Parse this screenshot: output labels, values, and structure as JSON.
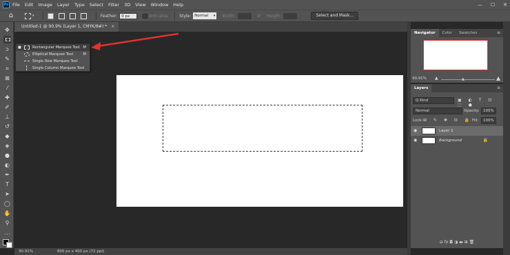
{
  "app": {
    "logo": "Ps"
  },
  "menu": [
    "File",
    "Edit",
    "Image",
    "Layer",
    "Type",
    "Select",
    "Filter",
    "3D",
    "View",
    "Window",
    "Help"
  ],
  "window_controls": {
    "minimize": "—",
    "maximize": "☐",
    "close": "✕"
  },
  "options_bar": {
    "feather_label": "Feather:",
    "feather_value": "0 px",
    "antialias_label": "Anti-alias",
    "style_label": "Style:",
    "style_value": "Normal",
    "width_label": "Width:",
    "height_label": "Height:",
    "swap_glyph": "⇄",
    "select_mask_button": "Select and Mask..."
  },
  "document": {
    "tab_title": "Untitled-1 @ 90.9% (Layer 1, CMYK/8#) *",
    "close_glyph": "×"
  },
  "tool_flyout": {
    "items": [
      {
        "mark": "■",
        "label": "Rectangular Marquee Tool",
        "shortcut": "M",
        "selected": true
      },
      {
        "mark": "",
        "label": "Elliptical Marquee Tool",
        "shortcut": "M",
        "selected": false
      },
      {
        "mark": "",
        "label": "Single Row Marquee Tool",
        "shortcut": "",
        "selected": false
      },
      {
        "mark": "",
        "label": "Single Column Marquee Tool",
        "shortcut": "",
        "selected": false
      }
    ]
  },
  "toolbar": {
    "tools": [
      {
        "name": "move-tool-icon",
        "glyph": "✥"
      },
      {
        "name": "rectangular-marquee-tool-icon",
        "glyph": ""
      },
      {
        "name": "lasso-tool-icon",
        "glyph": "ↄ"
      },
      {
        "name": "quick-selection-tool-icon",
        "glyph": "✎"
      },
      {
        "name": "crop-tool-icon",
        "glyph": "⌗"
      },
      {
        "name": "frame-tool-icon",
        "glyph": "⊠"
      },
      {
        "name": "eyedropper-tool-icon",
        "glyph": "⁄"
      },
      {
        "name": "spot-healing-tool-icon",
        "glyph": "✚"
      },
      {
        "name": "brush-tool-icon",
        "glyph": "✐"
      },
      {
        "name": "clone-stamp-tool-icon",
        "glyph": "⊥"
      },
      {
        "name": "history-brush-tool-icon",
        "glyph": "↺"
      },
      {
        "name": "eraser-tool-icon",
        "glyph": "◆"
      },
      {
        "name": "paint-bucket-tool-icon",
        "glyph": "◈"
      },
      {
        "name": "blur-tool-icon",
        "glyph": "●"
      },
      {
        "name": "dodge-tool-icon",
        "glyph": "◐"
      },
      {
        "name": "pen-tool-icon",
        "glyph": "✒"
      },
      {
        "name": "type-tool-icon",
        "glyph": "T"
      },
      {
        "name": "path-selection-tool-icon",
        "glyph": "➤"
      },
      {
        "name": "ellipse-tool-icon",
        "glyph": "◯"
      },
      {
        "name": "hand-tool-icon",
        "glyph": "✋"
      },
      {
        "name": "zoom-tool-icon",
        "glyph": "⚲"
      },
      {
        "name": "edit-toolbar-icon",
        "glyph": "…"
      }
    ]
  },
  "status_bar": {
    "zoom": "90.91%",
    "doc_size": "800 px x 400 px (72 ppi)",
    "arrow": "›"
  },
  "navigator_panel": {
    "tabs": [
      "Navigator",
      "Color",
      "Swatches"
    ],
    "menu_glyph": "≡",
    "zoom": "90.91%",
    "small_mountain": "▲",
    "large_mountain": "▲",
    "knob": "▲"
  },
  "layers_panel": {
    "tabs": [
      "Layers"
    ],
    "menu_glyph": "≡",
    "filter_kind": "Q Kind",
    "filter_icons": "▣ ◐ T ⊡ ⬚ ●",
    "blend_mode": "Normal",
    "opacity_label": "Opacity:",
    "opacity_value": "100%",
    "lock_label": "Lock:",
    "lock_icons": "⊞ ✎ ✥ ⊡ 🔒",
    "fill_label": "Fill:",
    "fill_value": "100%",
    "layers": [
      {
        "name": "Layer 1",
        "eye": "◉",
        "lock": "",
        "selected": true
      },
      {
        "name": "Background",
        "eye": "◉",
        "lock": "🔒",
        "selected": false
      }
    ],
    "footer_icons": "⊖ fx ◘ ◑ ▬ ⊞ 🗑"
  },
  "colors": {
    "accent_red": "#e0332f",
    "panel_bg": "#535353",
    "workspace_bg": "#282828"
  }
}
